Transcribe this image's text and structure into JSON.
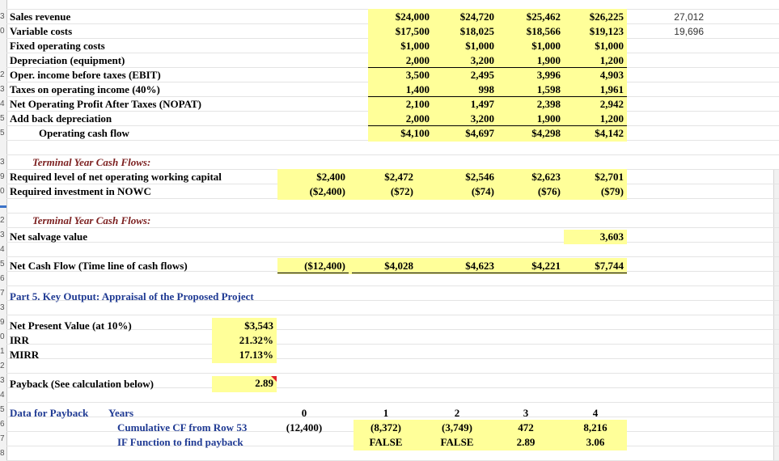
{
  "rows": {
    "sales_revenue": {
      "label": "Sales revenue",
      "y": [
        "$24,000",
        "$24,720",
        "$25,462",
        "$26,225"
      ],
      "side": "27,012"
    },
    "variable_costs": {
      "label": "Variable costs",
      "y": [
        "$17,500",
        "$18,025",
        "$18,566",
        "$19,123"
      ],
      "side": "19,696"
    },
    "fixed_costs": {
      "label": "Fixed operating costs",
      "y": [
        "$1,000",
        "$1,000",
        "$1,000",
        "$1,000"
      ]
    },
    "depreciation": {
      "label": "Depreciation (equipment)",
      "y": [
        "2,000",
        "3,200",
        "1,900",
        "1,200"
      ]
    },
    "ebit": {
      "label": "Oper. income before taxes (EBIT)",
      "y": [
        "3,500",
        "2,495",
        "3,996",
        "4,903"
      ]
    },
    "taxes": {
      "label": "Taxes on operating income (40%)",
      "y": [
        "1,400",
        "998",
        "1,598",
        "1,961"
      ]
    },
    "nopat": {
      "label": "Net Operating Profit After Taxes (NOPAT)",
      "y": [
        "2,100",
        "1,497",
        "2,398",
        "2,942"
      ]
    },
    "add_dep": {
      "label": "Add back depreciation",
      "y": [
        "2,000",
        "3,200",
        "1,900",
        "1,200"
      ]
    },
    "ocf": {
      "label": "Operating cash flow",
      "y": [
        "$4,100",
        "$4,697",
        "$4,298",
        "$4,142"
      ]
    }
  },
  "terminal1": {
    "heading": "Terminal Year Cash Flows:",
    "nowc_level": {
      "label": "Required level of net operating working capital",
      "y": [
        "$2,400",
        "$2,472",
        "$2,546",
        "$2,623",
        "$2,701"
      ]
    },
    "nowc_invest": {
      "label": "Required investment in NOWC",
      "y": [
        "($2,400)",
        "($72)",
        "($74)",
        "($76)",
        "($79)"
      ]
    }
  },
  "terminal2": {
    "heading": "Terminal Year Cash Flows:",
    "salvage": {
      "label": "Net salvage value",
      "value": "3,603"
    }
  },
  "ncf": {
    "label": "Net Cash Flow (Time line of cash flows)",
    "y": [
      "($12,400)",
      "$4,028",
      "$4,623",
      "$4,221",
      "$7,744"
    ]
  },
  "part5": {
    "title": "Part 5.  Key Output:  Appraisal of the Proposed Project"
  },
  "npv": {
    "label": "Net Present Value (at 10%)",
    "value": "$3,543"
  },
  "irr": {
    "label": "IRR",
    "value": "21.32%"
  },
  "mirr": {
    "label": "MIRR",
    "value": "17.13%"
  },
  "payback": {
    "label": "Payback (See calculation below)",
    "value": "2.89"
  },
  "payback_data": {
    "label": "Data for Payback",
    "years_label": "Years",
    "years": [
      "0",
      "1",
      "2",
      "3",
      "4"
    ],
    "cum_label": "Cumulative CF from Row 53",
    "cum": [
      "(12,400)",
      "(8,372)",
      "(3,749)",
      "472",
      "8,216"
    ],
    "if_label": "IF Function to find payback",
    "if": [
      "",
      "FALSE",
      "FALSE",
      "2.89",
      "3.06"
    ]
  },
  "row_numbers": [
    "3",
    "0",
    "",
    "",
    "2",
    "3",
    "4",
    "5",
    "5",
    "",
    "3",
    "9",
    "0",
    "",
    "2",
    "3",
    "4",
    "5",
    "6",
    "7",
    "3",
    "9",
    "0",
    "1",
    "2",
    "3",
    "4",
    "5",
    "6",
    "7",
    "8"
  ]
}
